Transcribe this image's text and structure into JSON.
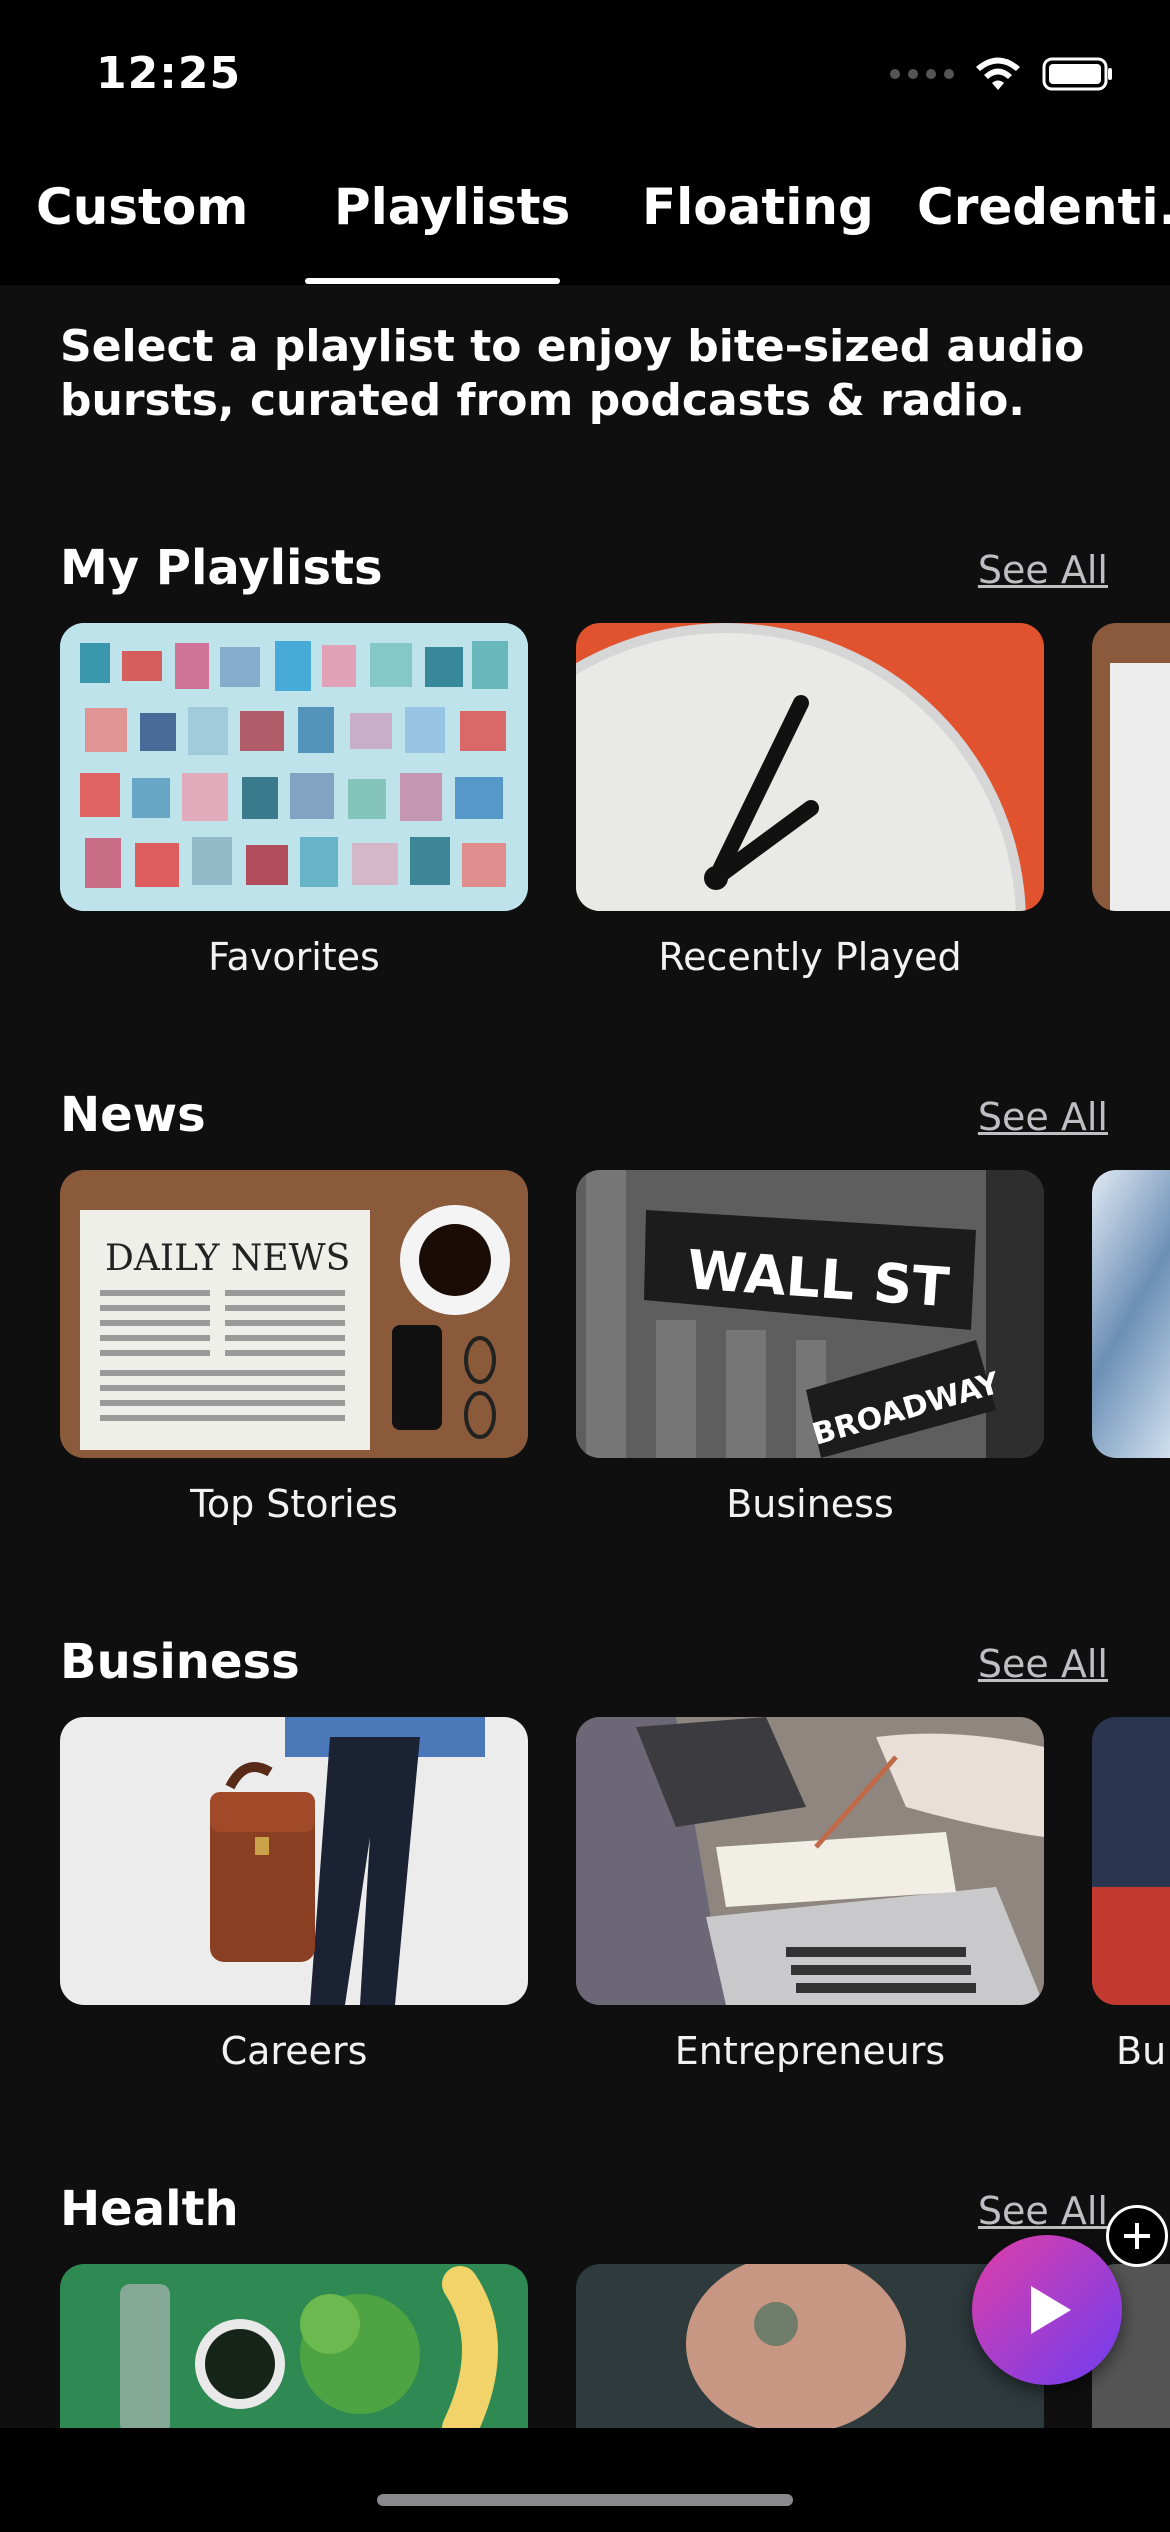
{
  "status_bar": {
    "time": "12:25"
  },
  "tabs": [
    {
      "label": "Custom"
    },
    {
      "label": "Playlists"
    },
    {
      "label": "Floating"
    },
    {
      "label": "Credenti..."
    }
  ],
  "intro_text": "Select a playlist to enjoy bite-sized audio bursts, curated from podcasts & radio.",
  "sections": [
    {
      "title": "My Playlists",
      "see_all": "See All",
      "items": [
        {
          "label": "Favorites"
        },
        {
          "label": "Recently Played"
        }
      ]
    },
    {
      "title": "News",
      "see_all": "See All",
      "items": [
        {
          "label": "Top Stories"
        },
        {
          "label": "Business"
        }
      ]
    },
    {
      "title": "Business",
      "see_all": "See All",
      "items": [
        {
          "label": "Careers"
        },
        {
          "label": "Entrepreneurs"
        },
        {
          "label": "Bu..."
        }
      ]
    },
    {
      "title": "Health",
      "see_all": "See All",
      "items": []
    }
  ],
  "images": {
    "newspaper_text": "DAILY NEWS",
    "street_sign": "WALL ST",
    "street_sign_2": "BROADWAY"
  },
  "colors": {
    "accent_start": "#e03fa6",
    "accent_end": "#6e3cf2",
    "background": "#0f0f10"
  }
}
